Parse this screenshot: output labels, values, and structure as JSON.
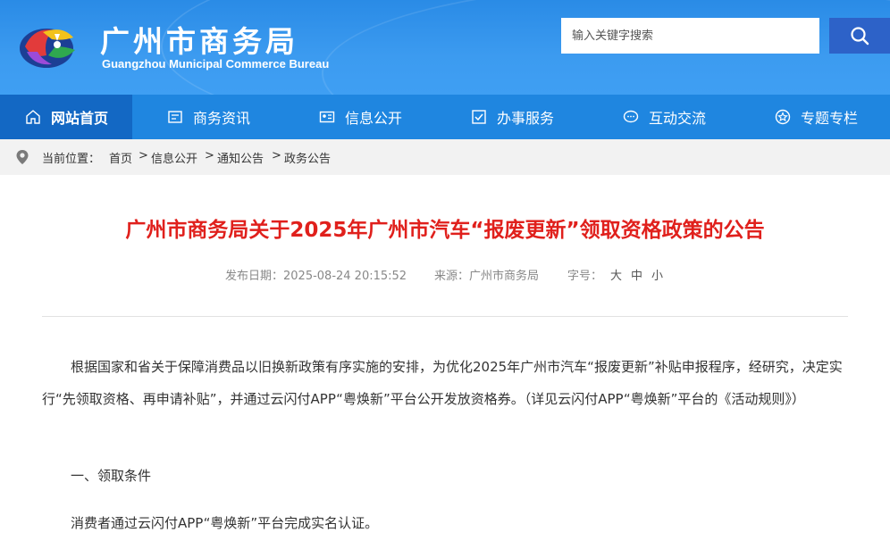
{
  "header": {
    "title_cn": "广州市商务局",
    "title_en": "Guangzhou Municipal Commerce Bureau",
    "logo_icon": "city-logo-icon"
  },
  "search": {
    "placeholder": "输入关键字搜索",
    "button_icon": "search-icon"
  },
  "nav": {
    "items": [
      {
        "label": "网站首页",
        "icon": "home-icon"
      },
      {
        "label": "商务资讯",
        "icon": "news-icon"
      },
      {
        "label": "信息公开",
        "icon": "id-card-icon"
      },
      {
        "label": "办事服务",
        "icon": "checkbox-icon"
      },
      {
        "label": "互动交流",
        "icon": "chat-icon"
      },
      {
        "label": "专题专栏",
        "icon": "star-icon"
      }
    ]
  },
  "breadcrumb": {
    "prefix": "当前位置：",
    "items": [
      "首页",
      "信息公开",
      "通知公告",
      "政务公告"
    ],
    "separator": ">"
  },
  "article": {
    "title": "广州市商务局关于2025年广州市汽车“报废更新”领取资格政策的公告",
    "date": "发布日期：2025-08-24 20:15:52",
    "source": "来源：广州市商务局",
    "size_label": "字号：",
    "size_options": [
      "大",
      "中",
      "小"
    ],
    "paragraphs": [
      "根据国家和省关于保障消费品以旧换新政策有序实施的安排，为优化2025年广州市汽车“报废更新”补贴申报程序，经研究，决定实行“先领取资格、再申请补贴”，并通过云闪付APP“粤焕新”平台公开发放资格券。（详见云闪付APP“粤焕新”平台的《活动规则》）",
      "一、领取条件",
      "消费者通过云闪付APP“粤焕新”平台完成实名认证。"
    ]
  },
  "colors": {
    "header_blue": "#3c9bf0",
    "nav_blue": "#1f86e0",
    "nav_active": "#1368c4",
    "search_button": "#2d62c8",
    "title_red": "#e0201c"
  }
}
